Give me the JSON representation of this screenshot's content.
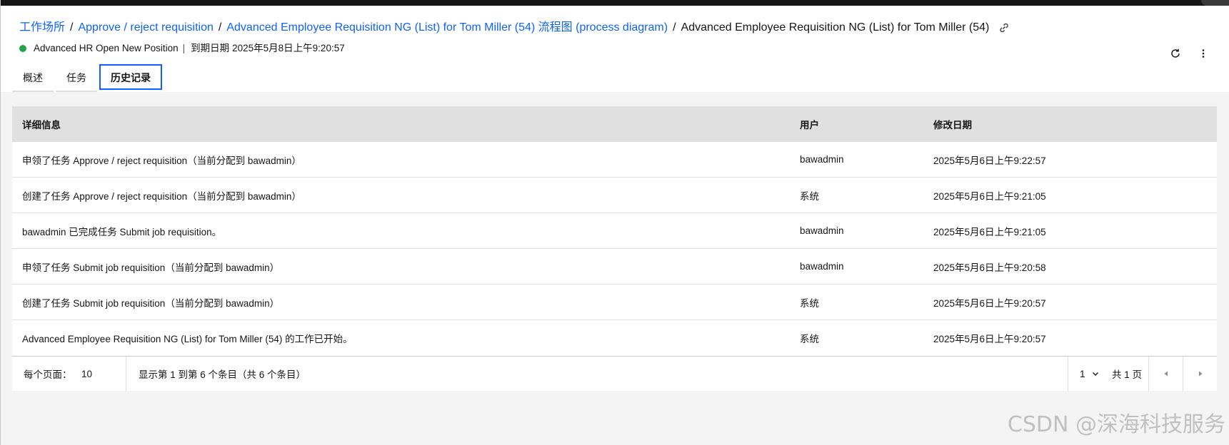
{
  "breadcrumb": {
    "items": [
      "工作场所",
      "Approve / reject requisition",
      "Advanced Employee Requisition NG (List) for Tom Miller (54) 流程图 (process diagram)"
    ],
    "current": "Advanced Employee Requisition NG (List) for Tom Miller (54)",
    "separator": "/"
  },
  "status": {
    "color": "#24a148",
    "process_name": "Advanced HR Open New Position",
    "separator": "|",
    "due_label": "到期日期",
    "due_value": "2025年5月8日上午9:20:57"
  },
  "tabs": [
    {
      "label": "概述",
      "active": false
    },
    {
      "label": "任务",
      "active": false
    },
    {
      "label": "历史记录",
      "active": true
    }
  ],
  "icons": {
    "link": "link-icon",
    "refresh": "refresh-icon",
    "overflow": "overflow-menu-icon",
    "chevron": "chevron-down-icon",
    "prev": "caret-left-icon",
    "next": "caret-right-icon"
  },
  "table": {
    "headers": [
      "详细信息",
      "用户",
      "修改日期"
    ],
    "rows": [
      [
        "申领了任务 Approve / reject requisition（当前分配到 bawadmin）",
        "bawadmin",
        "2025年5月6日上午9:22:57"
      ],
      [
        "创建了任务 Approve / reject requisition（当前分配到 bawadmin）",
        "系统",
        "2025年5月6日上午9:21:05"
      ],
      [
        "bawadmin 已完成任务 Submit job requisition。",
        "bawadmin",
        "2025年5月6日上午9:21:05"
      ],
      [
        "申领了任务 Submit job requisition（当前分配到 bawadmin）",
        "bawadmin",
        "2025年5月6日上午9:20:58"
      ],
      [
        "创建了任务 Submit job requisition（当前分配到 bawadmin）",
        "系统",
        "2025年5月6日上午9:20:57"
      ],
      [
        "Advanced Employee Requisition NG (List) for Tom Miller (54) 的工作已开始。",
        "系统",
        "2025年5月6日上午9:20:57"
      ]
    ]
  },
  "pagination": {
    "per_page_label": "每个页面：",
    "per_page_value": "10",
    "range_text": "显示第 1 到第 6 个条目（共 6 个条目）",
    "page_value": "1",
    "total_pages_text": "共 1 页"
  },
  "colors": {
    "link": "#0f62fe",
    "accent_border": "#0f62fe",
    "table_header_bg": "#e0e0e0",
    "content_bg": "#f4f4f4"
  },
  "watermark": "CSDN @深海科技服务"
}
